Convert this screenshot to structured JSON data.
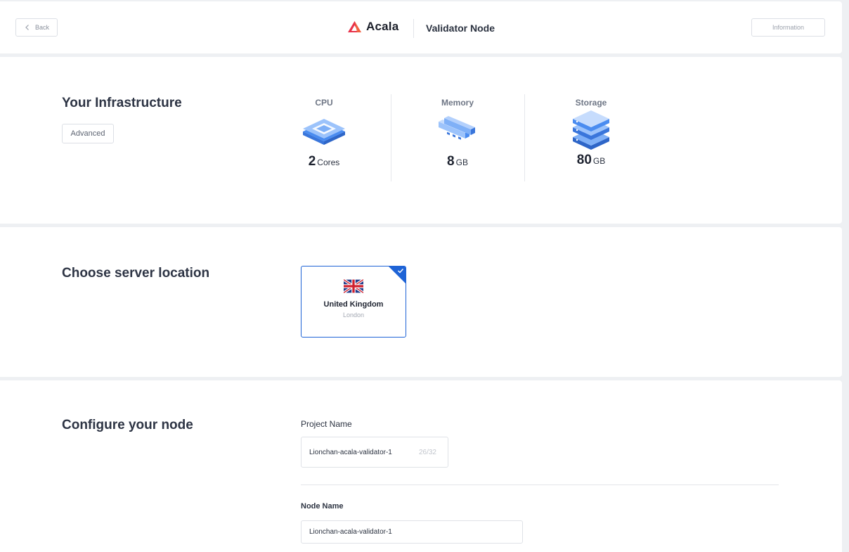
{
  "header": {
    "back_label": "Back",
    "brand_name": "Acala",
    "page_title": "Validator Node",
    "info_label": "Information",
    "brand_color": "#e8324a"
  },
  "infrastructure": {
    "title": "Your Infrastructure",
    "advanced_label": "Advanced",
    "specs": [
      {
        "label": "CPU",
        "value": "2",
        "unit": "Cores",
        "icon": "cpu-icon"
      },
      {
        "label": "Memory",
        "value": "8",
        "unit": "GB",
        "icon": "memory-icon"
      },
      {
        "label": "Storage",
        "value": "80",
        "unit": "GB",
        "icon": "storage-icon"
      }
    ]
  },
  "location": {
    "title": "Choose server location",
    "selected": {
      "country": "United Kingdom",
      "city": "London",
      "flag": "uk-flag-icon"
    },
    "accent_color": "#1e63d6"
  },
  "config": {
    "title": "Configure your node",
    "project_name_label": "Project Name",
    "project_name_value": "Lionchan-acala-validator-1",
    "project_name_counter": "26/32",
    "node_name_label": "Node Name",
    "node_name_value": "Lionchan-acala-validator-1"
  }
}
